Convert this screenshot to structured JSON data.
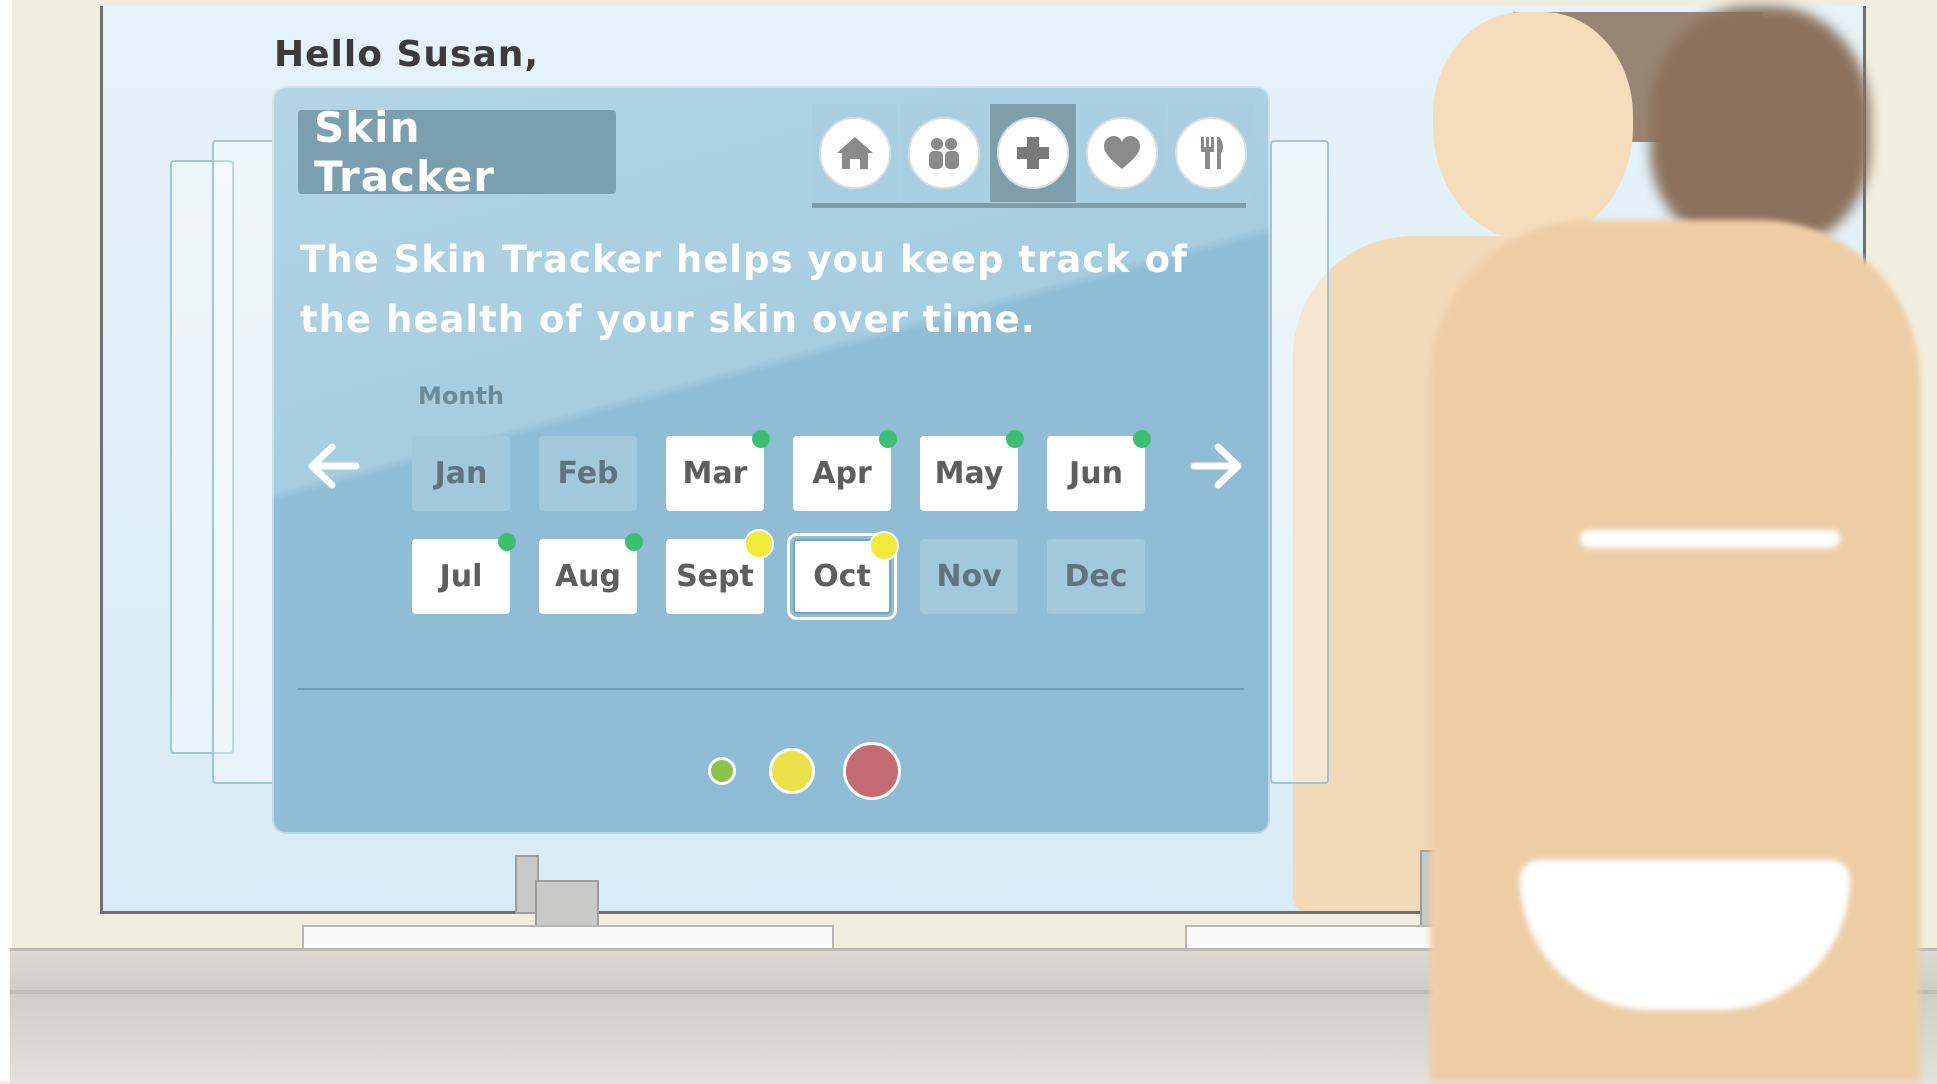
{
  "greeting": "Hello Susan,",
  "tracker": {
    "title": "Skin Tracker",
    "description": "The Skin Tracker helps you keep track of the health of your skin over time.",
    "month_label": "Month",
    "nav": [
      {
        "icon": "home-icon"
      },
      {
        "icon": "people-icon"
      },
      {
        "icon": "plus-icon",
        "active": true
      },
      {
        "icon": "heart-icon"
      },
      {
        "icon": "fork-knife-icon"
      }
    ],
    "months": [
      {
        "label": "Jan",
        "status": "none"
      },
      {
        "label": "Feb",
        "status": "none"
      },
      {
        "label": "Mar",
        "status": "green"
      },
      {
        "label": "Apr",
        "status": "green"
      },
      {
        "label": "May",
        "status": "green"
      },
      {
        "label": "Jun",
        "status": "green"
      },
      {
        "label": "Jul",
        "status": "green"
      },
      {
        "label": "Aug",
        "status": "green"
      },
      {
        "label": "Sept",
        "status": "yellow"
      },
      {
        "label": "Oct",
        "status": "yellow",
        "selected": true
      },
      {
        "label": "Nov",
        "status": "none"
      },
      {
        "label": "Dec",
        "status": "none"
      }
    ],
    "legend": [
      {
        "color": "#8bc34a",
        "level": "small"
      },
      {
        "color": "#ebe04a",
        "level": "medium"
      },
      {
        "color": "#c46a72",
        "level": "large"
      }
    ]
  },
  "colors": {
    "panel": "#a6cde0",
    "title_bg": "#7b9fae",
    "green": "#3dbf73",
    "yellow": "#f1e93c"
  }
}
